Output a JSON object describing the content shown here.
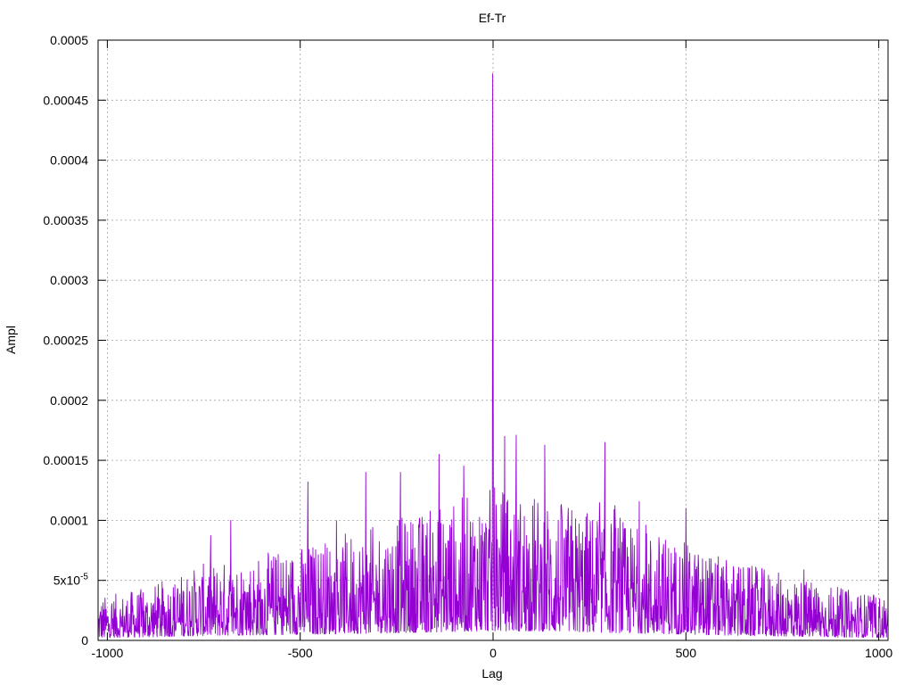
{
  "chart_data": {
    "type": "line",
    "title": "Ef-Tr",
    "xlabel": "Lag",
    "ylabel": "Ampl",
    "xlim": [
      -1024,
      1024
    ],
    "ylim": [
      0,
      0.0005
    ],
    "grid": true,
    "x_ticks": [
      {
        "value": -1000,
        "label": "-1000"
      },
      {
        "value": -500,
        "label": "-500"
      },
      {
        "value": 0,
        "label": "0"
      },
      {
        "value": 500,
        "label": "500"
      },
      {
        "value": 1000,
        "label": "1000"
      }
    ],
    "y_ticks": [
      {
        "value": 0,
        "label": "0"
      },
      {
        "value": 5e-05,
        "label": "5x10-5",
        "mantissa": "5x10",
        "exponent": "-5"
      },
      {
        "value": 0.0001,
        "label": "0.0001"
      },
      {
        "value": 0.00015,
        "label": "0.00015"
      },
      {
        "value": 0.0002,
        "label": "0.0002"
      },
      {
        "value": 0.00025,
        "label": "0.00025"
      },
      {
        "value": 0.0003,
        "label": "0.0003"
      },
      {
        "value": 0.00035,
        "label": "0.00035"
      },
      {
        "value": 0.0004,
        "label": "0.0004"
      },
      {
        "value": 0.00045,
        "label": "0.00045"
      },
      {
        "value": 0.0005,
        "label": "0.0005"
      }
    ],
    "series": [
      {
        "color": "#9400d3",
        "notable_points": [
          {
            "x": -1,
            "y": 0.000472
          },
          {
            "x": 0,
            "y": 0.000312
          },
          {
            "x": 60,
            "y": 0.000171
          },
          {
            "x": 30,
            "y": 0.00017
          },
          {
            "x": 290,
            "y": 0.000165
          },
          {
            "x": -140,
            "y": 0.000155
          },
          {
            "x": -240,
            "y": 0.00014
          },
          {
            "x": -330,
            "y": 0.00014
          },
          {
            "x": -480,
            "y": 0.000132
          },
          {
            "x": -680,
            "y": 0.0001
          },
          {
            "x": 500,
            "y": 0.00011
          }
        ],
        "envelope": [
          {
            "x": -1024,
            "y": 4.5e-05
          },
          {
            "x": -900,
            "y": 5.5e-05
          },
          {
            "x": -750,
            "y": 8e-05
          },
          {
            "x": -600,
            "y": 9e-05
          },
          {
            "x": -450,
            "y": 0.000105
          },
          {
            "x": -300,
            "y": 0.00012
          },
          {
            "x": -150,
            "y": 0.00014
          },
          {
            "x": 0,
            "y": 0.00016
          },
          {
            "x": 150,
            "y": 0.00015
          },
          {
            "x": 300,
            "y": 0.00013
          },
          {
            "x": 450,
            "y": 0.00011
          },
          {
            "x": 600,
            "y": 8.5e-05
          },
          {
            "x": 750,
            "y": 7e-05
          },
          {
            "x": 900,
            "y": 5.5e-05
          },
          {
            "x": 1024,
            "y": 4.5e-05
          }
        ]
      }
    ]
  }
}
